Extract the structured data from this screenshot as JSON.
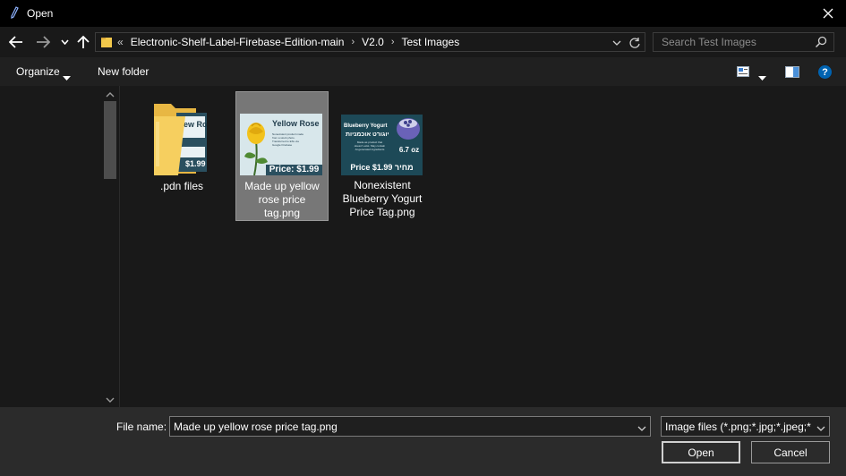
{
  "window": {
    "title": "Open",
    "close_icon": "close-icon",
    "title_icon": "pen-icon"
  },
  "nav": {
    "back_icon": "arrow-left-icon",
    "forward_icon": "arrow-right-icon",
    "recent_icon": "chevron-down-icon",
    "up_icon": "arrow-up-icon"
  },
  "address": {
    "overflow": "«",
    "crumbs": [
      "Electronic-Shelf-Label-Firebase-Edition-main",
      "V2.0",
      "Test Images"
    ],
    "separator": "›"
  },
  "search": {
    "placeholder": "Search Test Images"
  },
  "toolbar": {
    "organize": "Organize",
    "new_folder": "New folder",
    "help": "?"
  },
  "files": [
    {
      "label": ".pdn files",
      "type": "folder",
      "selected": false
    },
    {
      "label": "Made up yellow rose price tag.png",
      "type": "image",
      "selected": true,
      "thumb": {
        "title": "Yellow Rose",
        "text1": "Nonexistent product made",
        "text2": "from a stock photo.",
        "text3": "Transferred to ESL via",
        "text4": "Google Firebase",
        "price": "Price: $1.99"
      }
    },
    {
      "label": "Nonexistent Blueberry Yogurt Price Tag.png",
      "type": "image",
      "selected": false,
      "thumb": {
        "title": "Blueberry Yogurt",
        "hebrew": "יוגורט אוכמניות",
        "text1": "Made as product that",
        "text2": "doesn't exist. May contain",
        "text3": "AI-generated ingredients",
        "size": "6.7 oz",
        "price": "Price $1.99 מחיר"
      }
    }
  ],
  "bottom": {
    "file_name_label": "File name:",
    "file_name_value": "Made up yellow rose price tag.png",
    "file_type_value": "Image files (*.png;*.jpg;*.jpeg;*",
    "open": "Open",
    "cancel": "Cancel"
  },
  "colors": {
    "accent": "#0063b1",
    "background": "#191919",
    "selection": "#777777"
  }
}
